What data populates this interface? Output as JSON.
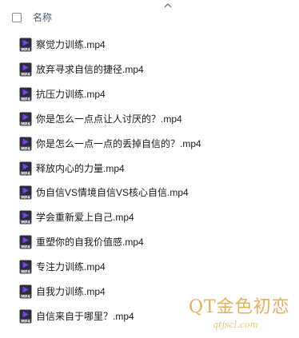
{
  "header": {
    "column_name": "名称"
  },
  "files": [
    {
      "name": "察觉力训练.mp4",
      "icon": "mp4-video-icon"
    },
    {
      "name": "放弃寻求自信的捷径.mp4",
      "icon": "mp4-video-icon"
    },
    {
      "name": "抗压力训练.mp4",
      "icon": "mp4-video-icon"
    },
    {
      "name": "你是怎么一点点让人讨厌的？.mp4",
      "icon": "mp4-video-icon"
    },
    {
      "name": "你是怎么一点一点的丢掉自信的？.mp4",
      "icon": "mp4-video-icon"
    },
    {
      "name": "释放内心的力量.mp4",
      "icon": "mp4-video-icon"
    },
    {
      "name": "伪自信VS情境自信VS核心自信.mp4",
      "icon": "mp4-video-icon"
    },
    {
      "name": "学会重新爱上自己.mp4",
      "icon": "mp4-video-icon"
    },
    {
      "name": "重塑你的自我价值感.mp4",
      "icon": "mp4-video-icon"
    },
    {
      "name": "专注力训练.mp4",
      "icon": "mp4-video-icon"
    },
    {
      "name": "自我力训练.mp4",
      "icon": "mp4-video-icon"
    },
    {
      "name": "自信来自于哪里？.mp4",
      "icon": "mp4-video-icon"
    }
  ],
  "watermark": {
    "main": "QT金色初恋",
    "sub": "qtjscl.com"
  },
  "colors": {
    "icon_purple": "#7b3fe4",
    "icon_dark": "#2b2b3a",
    "watermark_gold": "#e3b05a"
  }
}
